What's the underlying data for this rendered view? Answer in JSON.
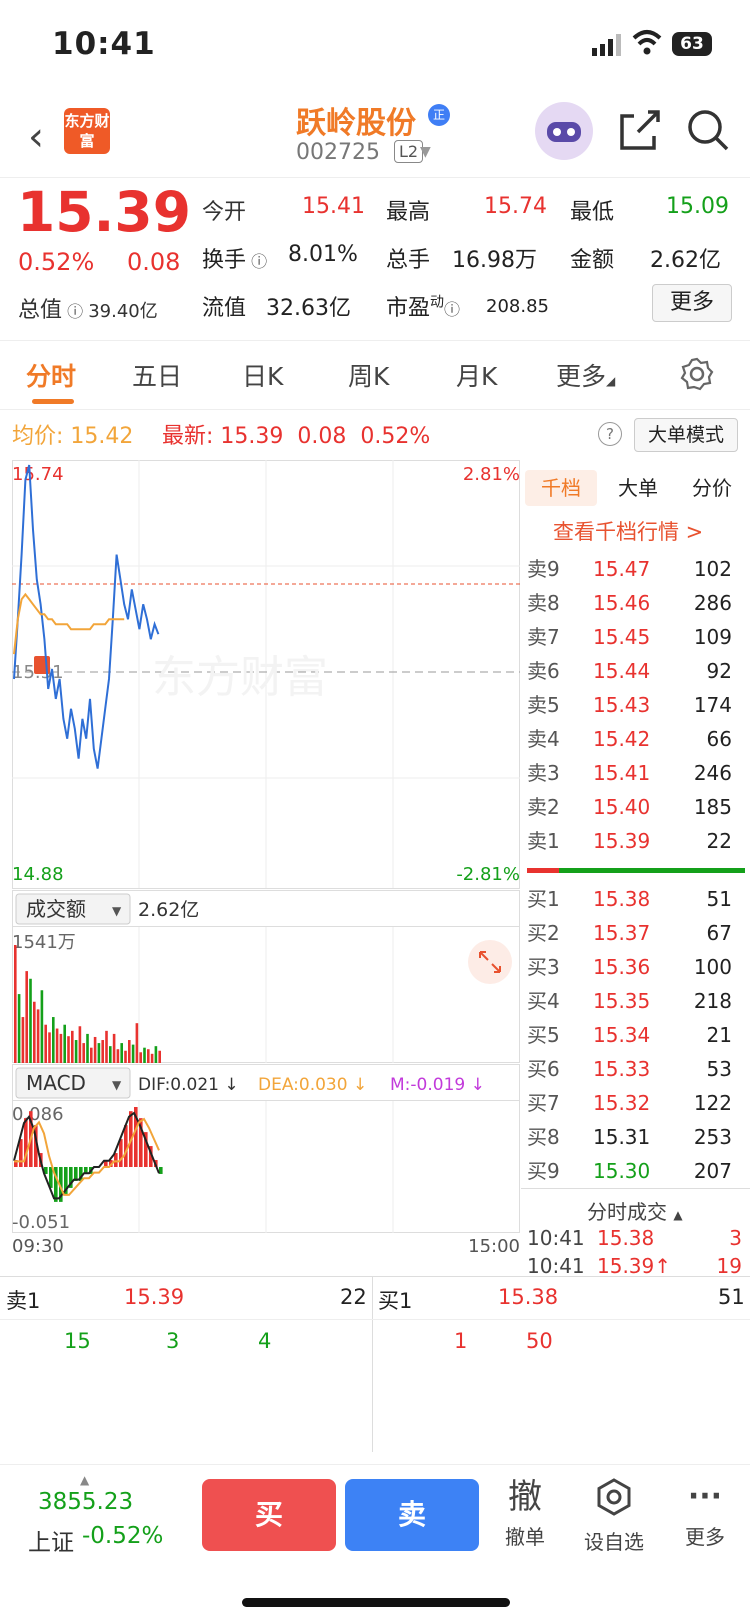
{
  "status": {
    "time": "10:41",
    "battery": "63"
  },
  "header": {
    "logo": "东方财富",
    "name": "跃岭股份",
    "badge": "正",
    "code": "002725",
    "level": "L2"
  },
  "quote": {
    "price": "15.39",
    "pct": "0.52%",
    "change": "0.08",
    "open_l": "今开",
    "open": "15.41",
    "high_l": "最高",
    "high": "15.74",
    "low_l": "最低",
    "low": "15.09",
    "turn_l": "换手",
    "turn": "8.01%",
    "vol_l": "总手",
    "vol": "16.98万",
    "amt_l": "金额",
    "amt": "2.62亿",
    "cap_l": "总值",
    "cap": "39.40亿",
    "float_l": "流值",
    "float": "32.63亿",
    "pe_l": "市盈",
    "pe_sup": "动",
    "pe": "208.85",
    "more": "更多"
  },
  "tabs": [
    "分时",
    "五日",
    "日K",
    "周K",
    "月K",
    "更多"
  ],
  "avgbar": {
    "avg_l": "均价:",
    "avg": "15.42",
    "new_l": "最新:",
    "new": "15.39",
    "chg": "0.08",
    "pct": "0.52%",
    "mode": "大单模式"
  },
  "chart_labels": {
    "top": "15.74",
    "top_pct": "2.81%",
    "mid": "15.31",
    "bot": "14.88",
    "bot_pct": "-2.81%",
    "watermark": "东方财富",
    "vol_sel": "成交额",
    "vol_total": "2.62亿",
    "vol_max": "1541万",
    "macd_sel": "MACD",
    "dif": "DIF:0.021 ↓",
    "dea": "DEA:0.030 ↓",
    "m": "M:-0.019 ↓",
    "macd_top": "0.086",
    "macd_bot": "-0.051",
    "t_start": "09:30",
    "t_end": "15:00"
  },
  "right": {
    "tabs": [
      "千档",
      "大单",
      "分价"
    ],
    "link": "查看千档行情 >",
    "sells": [
      [
        "卖9",
        "15.47",
        "102"
      ],
      [
        "卖8",
        "15.46",
        "286"
      ],
      [
        "卖7",
        "15.45",
        "109"
      ],
      [
        "卖6",
        "15.44",
        "92"
      ],
      [
        "卖5",
        "15.43",
        "174"
      ],
      [
        "卖4",
        "15.42",
        "66"
      ],
      [
        "卖3",
        "15.41",
        "246"
      ],
      [
        "卖2",
        "15.40",
        "185"
      ],
      [
        "卖1",
        "15.39",
        "22"
      ]
    ],
    "buys": [
      [
        "买1",
        "15.38",
        "51"
      ],
      [
        "买2",
        "15.37",
        "67"
      ],
      [
        "买3",
        "15.36",
        "100"
      ],
      [
        "买4",
        "15.35",
        "218"
      ],
      [
        "买5",
        "15.34",
        "21"
      ],
      [
        "买6",
        "15.33",
        "53"
      ],
      [
        "买7",
        "15.32",
        "122"
      ],
      [
        "买8",
        "15.31",
        "253"
      ],
      [
        "买9",
        "15.30",
        "207"
      ]
    ],
    "trade_title": "分时成交",
    "trades": [
      [
        "10:41",
        "15.38",
        "3"
      ],
      [
        "10:41",
        "15.39↑",
        "19"
      ]
    ]
  },
  "bottom": {
    "s_l": "卖1",
    "s_p": "15.39",
    "s_v": "22",
    "b_l": "买1",
    "b_p": "15.38",
    "b_v": "51",
    "s_q": [
      "15",
      "3",
      "4"
    ],
    "b_q": [
      "1",
      "50"
    ]
  },
  "footer": {
    "index": "3855.23",
    "index_name": "上证",
    "index_pct": "-0.52%",
    "buy": "买",
    "sell": "卖",
    "cancel_icon": "撤",
    "cancel": "撤单",
    "fav": "设自选",
    "more": "更多"
  },
  "chart_data": {
    "type": "line",
    "title": "",
    "x_range": [
      "09:30",
      "15:00"
    ],
    "y_range": [
      14.88,
      15.74
    ],
    "series": [
      {
        "values": [
          15.3,
          15.42,
          15.55,
          15.7,
          15.73,
          15.6,
          15.5,
          15.45,
          15.38,
          15.28,
          15.32,
          15.26,
          15.3,
          15.22,
          15.18,
          15.24,
          15.2,
          15.14,
          15.22,
          15.18,
          15.26,
          15.16,
          15.12,
          15.18,
          15.24,
          15.3,
          15.42,
          15.55,
          15.5,
          15.45,
          15.42,
          15.48,
          15.44,
          15.4,
          15.45,
          15.42,
          15.38,
          15.41,
          15.39
        ]
      },
      {
        "values": [
          15.35,
          15.42,
          15.46,
          15.47,
          15.46,
          15.45,
          15.44,
          15.43,
          15.43,
          15.42,
          15.42,
          15.41,
          15.41,
          15.41,
          15.41,
          15.4,
          15.4,
          15.4,
          15.4,
          15.4,
          15.4,
          15.41,
          15.41,
          15.41,
          15.41,
          15.42,
          15.42,
          15.42,
          15.42,
          15.42
        ]
      }
    ],
    "volume": [
      1541,
      900,
      600,
      1200,
      1100,
      800,
      700,
      950,
      500,
      400,
      600,
      450,
      380,
      500,
      350,
      420,
      300,
      480,
      260,
      380,
      200,
      340,
      260,
      300,
      420,
      220,
      380,
      180,
      260,
      160,
      300,
      240,
      520,
      140,
      200,
      180,
      120,
      220,
      160
    ],
    "macd": [
      0.01,
      0.04,
      0.07,
      0.08,
      0.06,
      0.02,
      -0.01,
      -0.03,
      -0.05,
      -0.05,
      -0.04,
      -0.03,
      -0.02,
      -0.02,
      -0.01,
      -0.01,
      0.0,
      0.0,
      0.01,
      0.01,
      0.02,
      0.04,
      0.06,
      0.08,
      0.086,
      0.07,
      0.05,
      0.03,
      0.01,
      -0.01
    ]
  }
}
